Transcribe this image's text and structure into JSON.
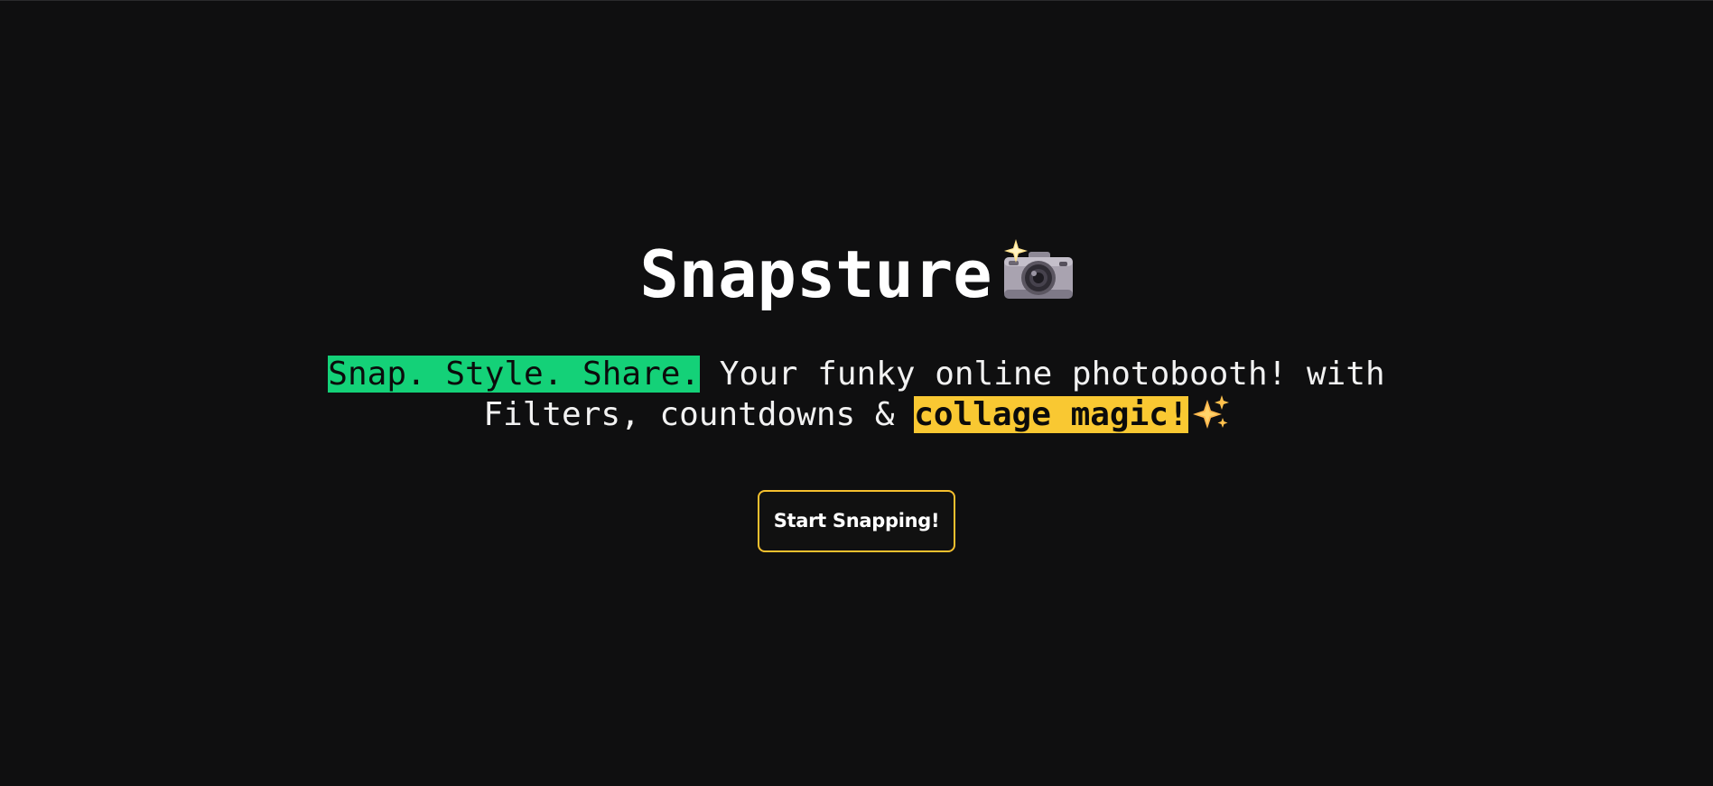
{
  "hero": {
    "title": "Snapsture",
    "title_icon": "camera-with-flash-icon",
    "tagline": {
      "highlight_green": "Snap. Style. Share.",
      "line1_rest": " Your funky online photobooth! with",
      "line2_start": "Filters, countdowns & ",
      "highlight_yellow": "collage magic!",
      "trailing_icon": "sparkles-icon"
    },
    "cta_label": "Start Snapping!"
  },
  "colors": {
    "background": "#0f0f10",
    "highlight_green": "#14d178",
    "highlight_yellow": "#f9c832",
    "cta_border": "#f5c02e",
    "text": "#ffffff"
  }
}
